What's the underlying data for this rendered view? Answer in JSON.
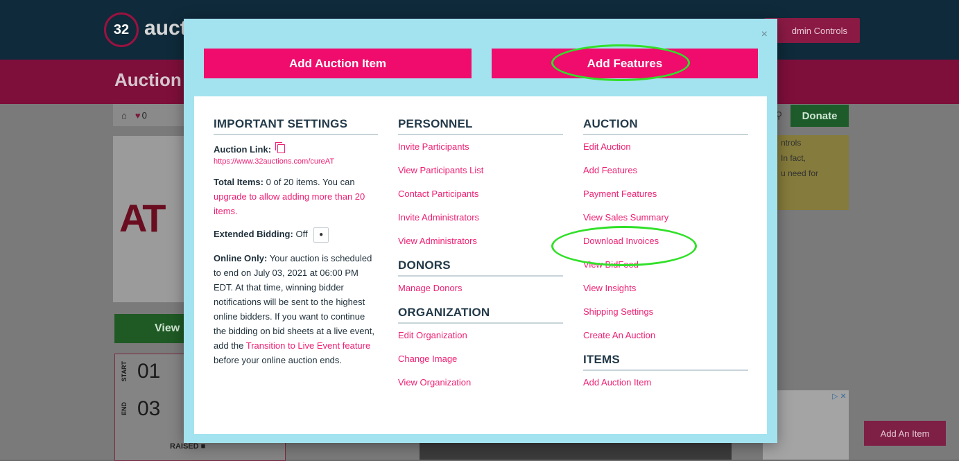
{
  "background": {
    "logo_number": "32",
    "logo_text": "auct",
    "admin_controls": "dmin Controls",
    "page_title": "Auction",
    "heart_count": "0",
    "donate": "Donate",
    "view_button": "View",
    "start_label": "START",
    "start_day": "01",
    "end_label": "END",
    "end_day": "03",
    "raised_label": "RAISED",
    "notice_lines": [
      "ntrols",
      "In fact,",
      "u need for"
    ],
    "add_an_item": "Add An Item",
    "ad_marker": "▷ ✕",
    "card_logo": "AT"
  },
  "modal": {
    "close": "×",
    "add_auction_item": "Add Auction Item",
    "add_features": "Add Features",
    "important": {
      "heading": "IMPORTANT SETTINGS",
      "auction_link_label": "Auction Link:",
      "auction_link_url": "https://www.32auctions.com/cureAT",
      "total_items_label": "Total Items:",
      "total_items_text": "0 of 20 items. You can",
      "upgrade_link": "upgrade to allow adding more than 20 items.",
      "extended_label": "Extended Bidding:",
      "extended_value": "Off",
      "online_label": "Online Only:",
      "online_text": "Your auction is scheduled to end on July 03, 2021 at 06:00 PM EDT. At that time, winning bidder notifications will be sent to the highest online bidders. If you want to continue the bidding on bid sheets at a live event, add the",
      "transition_link": "Transition to Live Event feature",
      "online_tail": "before your online auction ends."
    },
    "personnel": {
      "heading": "PERSONNEL",
      "links": [
        "Invite Participants",
        "View Participants List",
        "Contact Participants",
        "Invite Administrators",
        "View Administrators"
      ]
    },
    "donors": {
      "heading": "DONORS",
      "links": [
        "Manage Donors"
      ]
    },
    "organization": {
      "heading": "ORGANIZATION",
      "links": [
        "Edit Organization",
        "Change Image",
        "View Organization"
      ]
    },
    "auction": {
      "heading": "AUCTION",
      "links": [
        "Edit Auction",
        "Add Features",
        "Payment Features",
        "View Sales Summary",
        "Download Invoices",
        "View BidFeed",
        "View Insights",
        "Shipping Settings",
        "Create An Auction"
      ]
    },
    "items": {
      "heading": "ITEMS",
      "links": [
        "Add Auction Item"
      ]
    }
  },
  "colors": {
    "modal_bg": "#a3e3ef",
    "accent_pink": "#ef0c6c",
    "highlight_green": "#32e02a"
  }
}
